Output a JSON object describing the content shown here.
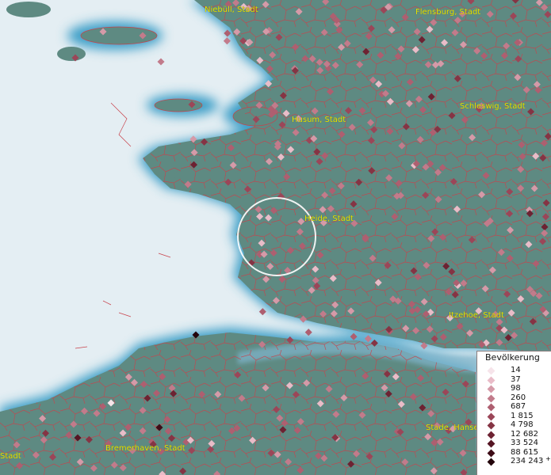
{
  "map": {
    "water_color": "#e4eef3",
    "land_color": "#5e8a82",
    "boundary_color": "#c8414a",
    "cities": [
      {
        "id": "niebuell",
        "label": "Niebüll, Stadt"
      },
      {
        "id": "flensburg",
        "label": "Flensburg, Stadt"
      },
      {
        "id": "schleswig",
        "label": "Schleswig, Stadt"
      },
      {
        "id": "husum",
        "label": "Husum, Stadt"
      },
      {
        "id": "heide",
        "label": "Heide, Stadt"
      },
      {
        "id": "itzehoe",
        "label": "Itzehoe, Stadt"
      },
      {
        "id": "stade",
        "label": "Stade, Hanse"
      },
      {
        "id": "bremerhaven",
        "label": "Bremerhaven, Stadt"
      },
      {
        "id": "stadt-left",
        "label": "Stadt"
      }
    ]
  },
  "legend": {
    "title": "Bevölkerung",
    "items": [
      {
        "label": "14",
        "color": "#f6e4ea"
      },
      {
        "label": "37",
        "color": "#e9bcc8"
      },
      {
        "label": "98",
        "color": "#d59aa8"
      },
      {
        "label": "260",
        "color": "#c27b8b"
      },
      {
        "label": "687",
        "color": "#ae5f70"
      },
      {
        "label": "1 815",
        "color": "#9b4658"
      },
      {
        "label": "4 798",
        "color": "#853444"
      },
      {
        "label": "12 682",
        "color": "#6d2232"
      },
      {
        "label": "33 524",
        "color": "#551523"
      },
      {
        "label": "88 615",
        "color": "#3d0c17"
      },
      {
        "label": "234 243",
        "color": "#23050b",
        "suffix": "+"
      }
    ]
  }
}
